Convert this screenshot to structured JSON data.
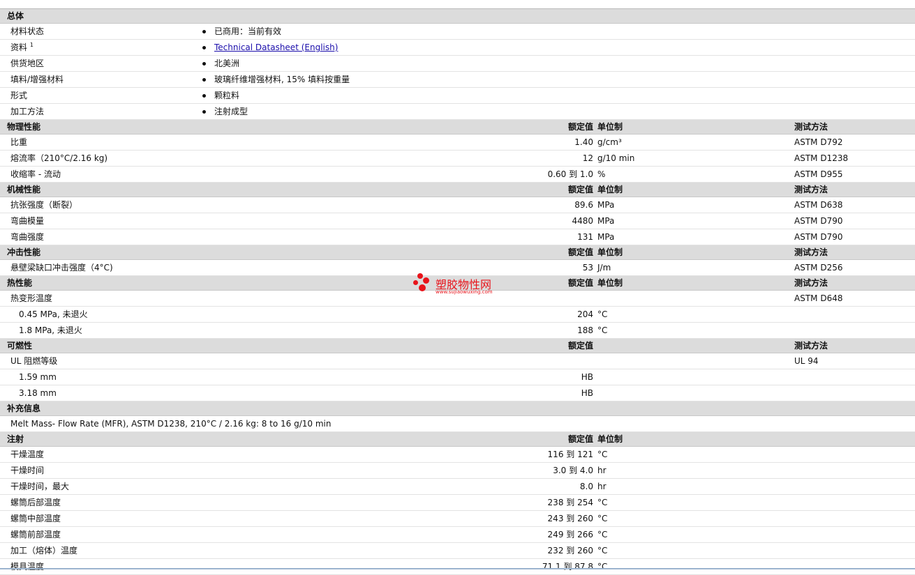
{
  "sections": {
    "general": {
      "title": "总体",
      "rows": [
        {
          "name": "材料状态",
          "value": "已商用：当前有效"
        },
        {
          "name": "资料",
          "sup": "1",
          "value": "Technical Datasheet (English)"
        },
        {
          "name": "供货地区",
          "value": "北美洲"
        },
        {
          "name": "填料/增强材料",
          "value": "玻璃纤维增强材料, 15% 填料按重量"
        },
        {
          "name": "形式",
          "value": "颗粒料"
        },
        {
          "name": "加工方法",
          "value": "注射成型"
        }
      ]
    },
    "headers": {
      "nominal": "额定值",
      "unit": "单位制",
      "test": "测试方法"
    },
    "physical": {
      "title": "物理性能",
      "rows": [
        {
          "name": "比重",
          "value": "1.40",
          "unit": "g/cm³",
          "test": "ASTM D792"
        },
        {
          "name": "熔流率（210°C/2.16 kg)",
          "value": "12",
          "unit": "g/10 min",
          "test": "ASTM D1238"
        },
        {
          "name": "收缩率 - 流动",
          "value": "0.60 到  1.0",
          "unit": "%",
          "test": "ASTM D955"
        }
      ]
    },
    "mechanical": {
      "title": "机械性能",
      "rows": [
        {
          "name": "抗张强度（断裂）",
          "value": "89.6",
          "unit": "MPa",
          "test": "ASTM D638"
        },
        {
          "name": "弯曲模量",
          "value": "4480",
          "unit": "MPa",
          "test": "ASTM D790"
        },
        {
          "name": "弯曲强度",
          "value": "131",
          "unit": "MPa",
          "test": "ASTM D790"
        }
      ]
    },
    "impact": {
      "title": "冲击性能",
      "rows": [
        {
          "name": "悬壁梁缺口冲击强度（4°C)",
          "value": "53",
          "unit": "J/m",
          "test": "ASTM D256"
        }
      ]
    },
    "thermal": {
      "title": "热性能",
      "rows": [
        {
          "name": "热变形温度",
          "value": "",
          "unit": "",
          "test": "ASTM D648"
        },
        {
          "name": "0.45 MPa, 未退火",
          "value": "204",
          "unit": "°C",
          "test": ""
        },
        {
          "name": "1.8 MPa, 未退火",
          "value": "188",
          "unit": "°C",
          "test": ""
        }
      ]
    },
    "flammability": {
      "title": "可燃性",
      "rows": [
        {
          "name": "UL 阻燃等级",
          "value": "",
          "test": "UL 94"
        },
        {
          "name": "1.59 mm",
          "value": "HB",
          "test": ""
        },
        {
          "name": "3.18 mm",
          "value": "HB",
          "test": ""
        }
      ]
    },
    "supplement": {
      "title": "补充信息",
      "text": "Melt Mass- Flow Rate (MFR), ASTM D1238, 210°C / 2.16 kg: 8 to 16 g/10 min"
    },
    "injection": {
      "title": "注射",
      "rows": [
        {
          "name": "干燥温度",
          "value": "116 到  121",
          "unit": "°C"
        },
        {
          "name": "干燥时间",
          "value": "3.0 到  4.0",
          "unit": "hr"
        },
        {
          "name": "干燥时间，最大",
          "value": "8.0",
          "unit": "hr"
        },
        {
          "name": "螺筒后部温度",
          "value": "238 到  254",
          "unit": "°C"
        },
        {
          "name": "螺筒中部温度",
          "value": "243 到  260",
          "unit": "°C"
        },
        {
          "name": "螺筒前部温度",
          "value": "249 到  266",
          "unit": "°C"
        },
        {
          "name": "加工（熔体）温度",
          "value": "232 到  260",
          "unit": "°C"
        },
        {
          "name": "模具温度",
          "value": "71.1 到  87.8",
          "unit": "°C"
        }
      ]
    }
  },
  "watermark": {
    "title": "塑胶物性网",
    "url": "www.sujiaowuxing.com"
  },
  "colors": {
    "header_bg": "#dcdcdc",
    "link": "#1a0dab",
    "watermark": "#e8141b"
  }
}
